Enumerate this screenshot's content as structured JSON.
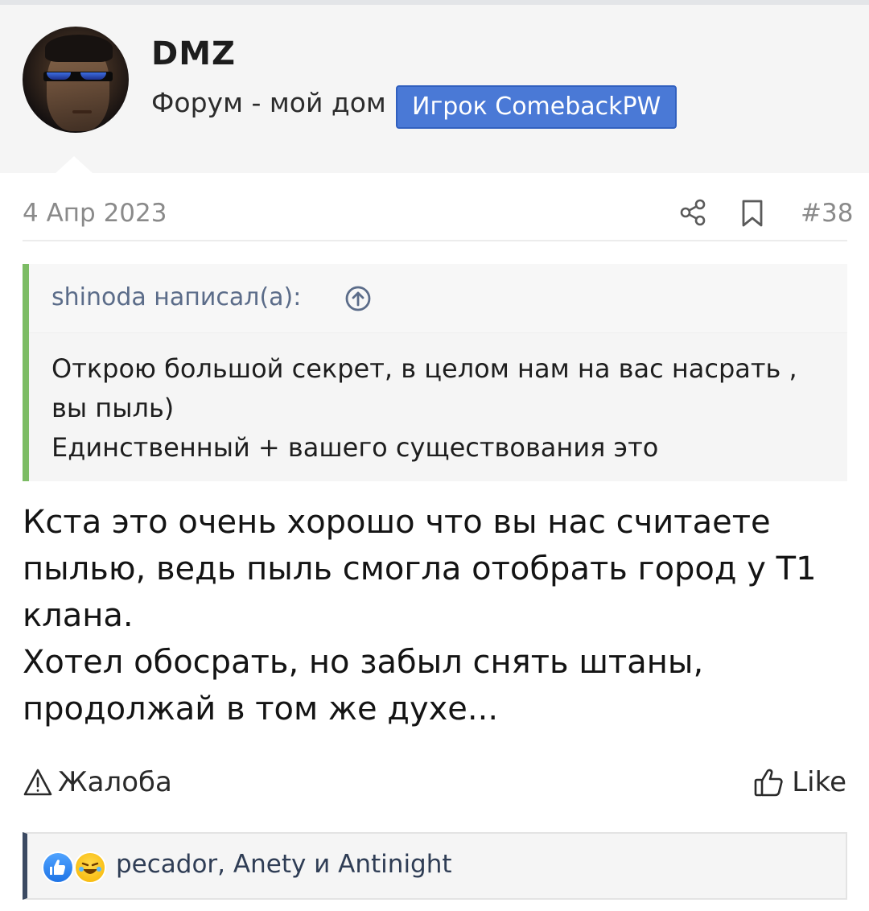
{
  "user": {
    "name": "DMZ",
    "title": "Форум - мой дом",
    "banner": "Игрок ComebackPW"
  },
  "post": {
    "date": "4 Апр 2023",
    "number": "#38",
    "icons": [
      "share-icon",
      "bookmark-icon"
    ]
  },
  "quote": {
    "author": "shinoda написал(а):",
    "lines": [
      "Открою большой секрет, в целом нам на вас насрать ,",
      "вы пыль)",
      "Единственный + вашего существования это"
    ]
  },
  "message": {
    "lines": [
      "Кста это очень хорошо что вы нас считаете",
      "пылью, ведь пыль смогла отобрать город у Т1",
      "клана.",
      "Хотел обосрать, но забыл снять штаны,",
      "продолжай в том же духе..."
    ]
  },
  "actions": {
    "report_label": "Жалоба",
    "like_label": "Like"
  },
  "reactions": {
    "icons": [
      "like-reaction-icon",
      "laugh-reaction-icon"
    ],
    "users": "pecador, Anety и Antinight"
  },
  "colors": {
    "banner": "#4a79d6",
    "quote_border": "#7cbc64",
    "reactions_border": "#3b4a62",
    "link": "#5b6c89"
  }
}
